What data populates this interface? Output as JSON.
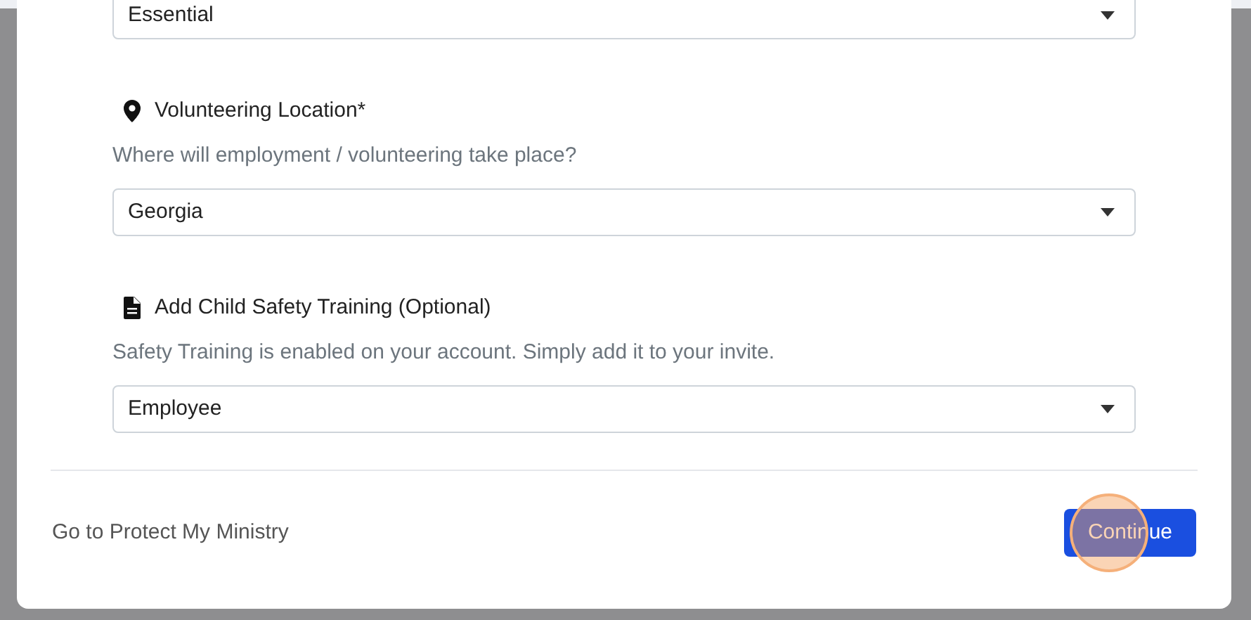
{
  "modal": {
    "fields": [
      {
        "kind": "select",
        "value": "Essential"
      },
      {
        "kind": "labeled",
        "label": "Volunteering Location*",
        "help": "Where will employment / volunteering take place?",
        "value": "Georgia"
      },
      {
        "kind": "labeled",
        "label": "Add Child Safety Training (Optional)",
        "help": "Safety Training is enabled on your account. Simply add it to your invite.",
        "value": "Employee"
      }
    ],
    "footer": {
      "link": "Go to Protect My Ministry",
      "button": "Continue",
      "highlighted": true
    }
  }
}
